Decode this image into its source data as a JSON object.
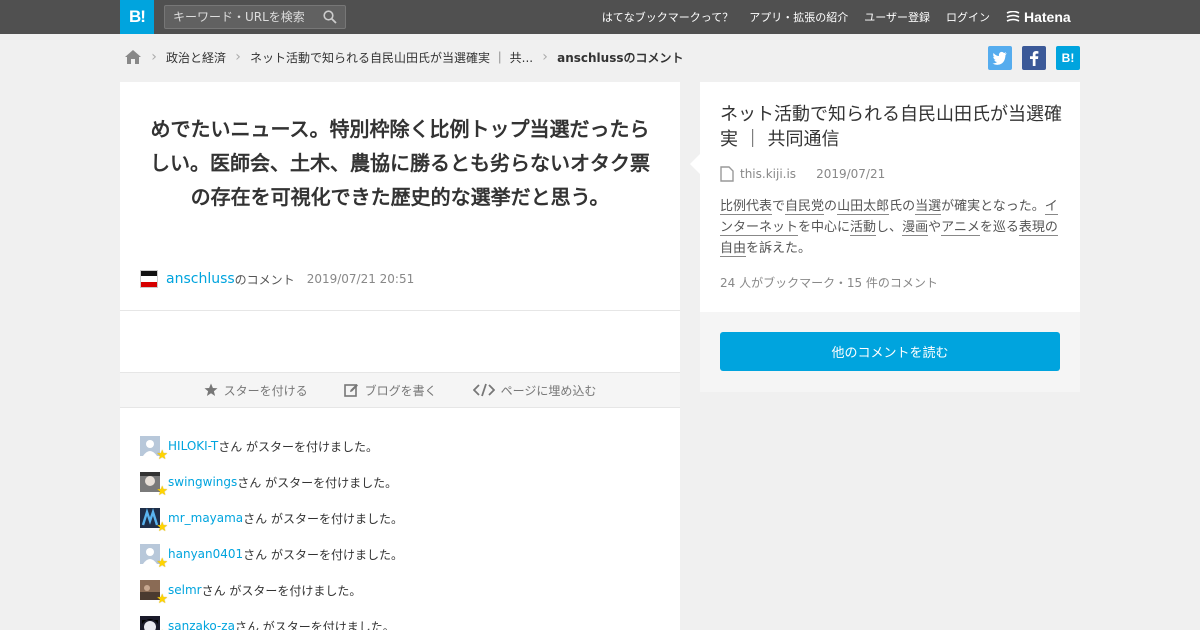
{
  "header": {
    "logo": "B!",
    "search_placeholder": "キーワード・URLを検索",
    "nav": [
      "はてなブックマークって？",
      "アプリ・拡張の紹介",
      "ユーザー登録",
      "ログイン"
    ],
    "brand": "Hatena"
  },
  "breadcrumb": {
    "items": [
      "政治と経済",
      "ネット活動で知られる自民山田氏が当選確実 ｜ 共..."
    ],
    "current": "anschlussのコメント"
  },
  "share": {
    "twitter": "t",
    "facebook": "f",
    "hatena": "B!"
  },
  "comment": {
    "text": "めでたいニュース。特別枠除く比例トップ当選だったらしい。医師会、土木、農協に勝るとも劣らないオタク票の存在を可視化できた歴史的な選挙だと思う。",
    "user": "anschluss",
    "suffix": "のコメント",
    "date": "2019/07/21 20:51"
  },
  "actions": {
    "star": "スターを付ける",
    "blog": "ブログを書く",
    "embed": "ページに埋め込む"
  },
  "star_suffix": "さん がスターを付けました。",
  "stars": [
    {
      "user": "HILOKI-T",
      "avatar": "#b8c8da"
    },
    {
      "user": "swingwings",
      "avatar": "#7a7a7a"
    },
    {
      "user": "mr_mayama",
      "avatar": "#1f2f4a"
    },
    {
      "user": "hanyan0401",
      "avatar": "#b8c8da"
    },
    {
      "user": "selmr",
      "avatar": "#8a6b55"
    },
    {
      "user": "sanzako-za",
      "avatar": "#1a1a2a"
    }
  ],
  "entry": {
    "title": "ネット活動で知られる自民山田氏が当選確実 ｜ 共同通信",
    "domain": "this.kiji.is",
    "date": "2019/07/21",
    "summary": [
      {
        "t": "比例代表",
        "kw": true
      },
      {
        "t": "で",
        "kw": false
      },
      {
        "t": "自民党",
        "kw": true
      },
      {
        "t": "の",
        "kw": false
      },
      {
        "t": "山田太郎",
        "kw": true
      },
      {
        "t": "氏の",
        "kw": false
      },
      {
        "t": "当選",
        "kw": true
      },
      {
        "t": "が確実となった。",
        "kw": false
      },
      {
        "t": "インターネット",
        "kw": true
      },
      {
        "t": "を中心に",
        "kw": false
      },
      {
        "t": "活動",
        "kw": true
      },
      {
        "t": "し、",
        "kw": false
      },
      {
        "t": "漫画",
        "kw": true
      },
      {
        "t": "や",
        "kw": false
      },
      {
        "t": "アニメ",
        "kw": true
      },
      {
        "t": "を巡る",
        "kw": false
      },
      {
        "t": "表現の自由",
        "kw": true
      },
      {
        "t": "を訴えた。",
        "kw": false
      }
    ],
    "counts": "24 人がブックマーク・15 件のコメント"
  },
  "more_button": "他のコメントを読む",
  "colors": {
    "accent": "#00a4de",
    "topbar": "#505050",
    "twitter": "#55acee",
    "facebook": "#3b5998"
  }
}
